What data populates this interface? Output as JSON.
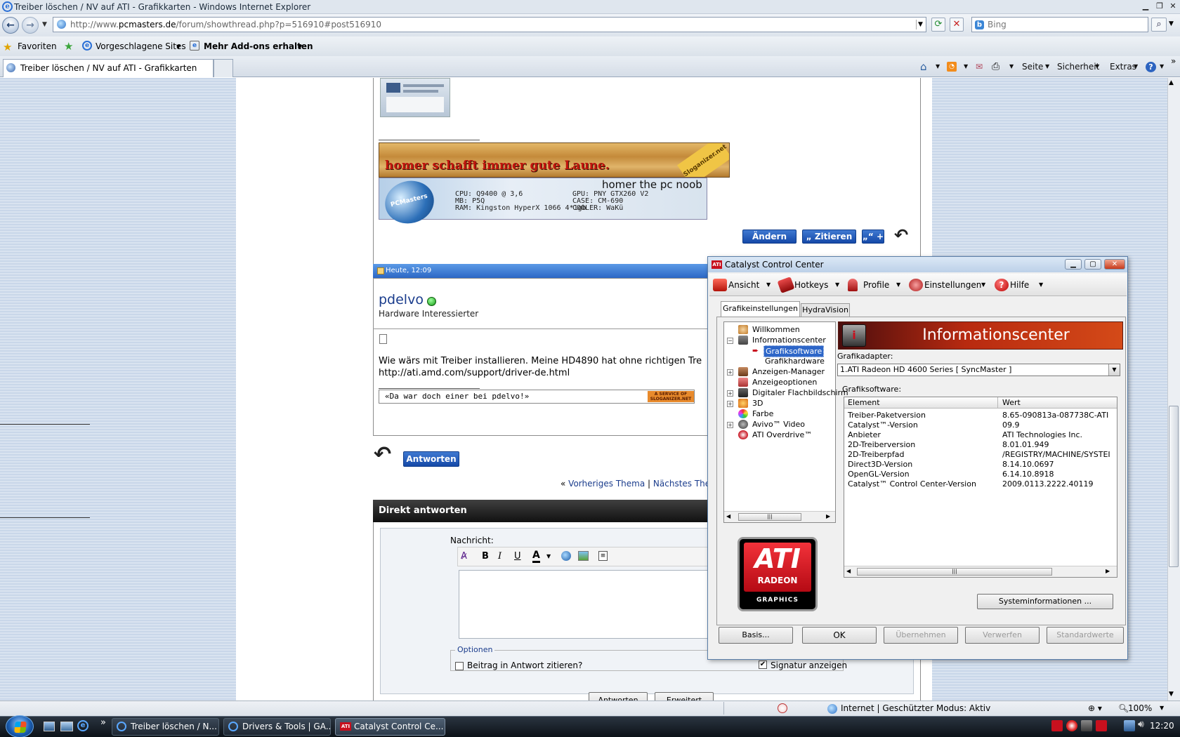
{
  "window": {
    "title": "Treiber löschen / NV auf ATI - Grafikkarten - Windows Internet Explorer"
  },
  "address": {
    "url_prefix": "http://www.",
    "url_domain": "pcmasters.de",
    "url_path": "/forum/showthread.php?p=516910#post516910",
    "search_placeholder": "Bing"
  },
  "favorites_bar": {
    "favorites": "Favoriten",
    "suggested": "Vorgeschlagene Sites",
    "addons": "Mehr Add-ons erhalten"
  },
  "tab": {
    "title": "Treiber löschen / NV auf ATI - Grafikkarten"
  },
  "command_bar": {
    "page": "Seite",
    "security": "Sicherheit",
    "extras": "Extras"
  },
  "post1": {
    "banner_title": "homer schafft immer gute Laune.",
    "banner_stamp": "Sloganizer.net",
    "sig_name": "homer the pc noob",
    "sig_logo": "PCMasters",
    "specs_left": [
      "CPU: Q9400 @ 3,6",
      "MB: P5Q",
      "RAM: Kingston HyperX 1066 4*1gb"
    ],
    "specs_right": [
      "GPU: PNY GTX260 V2",
      "CASE: CM-690",
      "COOLER: WaKü"
    ],
    "buttons": {
      "edit": "Ändern",
      "quote": "„ Zitieren “",
      "multi": "„“ +"
    }
  },
  "post2": {
    "date": "Heute, 12:09",
    "username": "pdelvo",
    "usertitle": "Hardware Interessierter",
    "text_line1": "Wie wärs mit Treiber installieren. Meine HD4890 hat ohne richtigen Tre",
    "text_line2": "http://ati.amd.com/support/driver-de.html",
    "signature": "«Da war doch einer bei pdelvo!»",
    "sloganizer_badge": "A SERVICE OF SLOGANIZER.NET"
  },
  "reply_button": "Antworten",
  "thread_nav": {
    "prefix": "«",
    "prev": "Vorheriges Thema",
    "sep": "|",
    "next": "Nächstes Ther"
  },
  "quick_reply": {
    "header": "Direkt antworten",
    "message_label": "Nachricht:",
    "options_legend": "Optionen",
    "quote_option": "Beitrag in Antwort zitieren?",
    "signature_option": "Signatur anzeigen",
    "submit": "Antworten",
    "advanced": "Erweitert"
  },
  "status_bar": {
    "zone": "Internet | Geschützter Modus: Aktiv",
    "zoom": "100%"
  },
  "taskbar": {
    "tasks": [
      "Treiber löschen / N...",
      "Drivers & Tools | GA...",
      "Catalyst Control Ce..."
    ],
    "clock": "12:20"
  },
  "ccc": {
    "title": "Catalyst Control Center",
    "logo_text": "ATI",
    "toolbar": {
      "view": "Ansicht",
      "hotkeys": "Hotkeys",
      "profiles": "Profile",
      "settings": "Einstellungen",
      "help": "Hilfe"
    },
    "tabs": {
      "graphics": "Grafikeinstellungen",
      "hydravision": "HydraVision"
    },
    "tree": [
      {
        "label": "Willkommen"
      },
      {
        "label": "Informationscenter"
      },
      {
        "label": "Grafiksoftware"
      },
      {
        "label": "Grafikhardware"
      },
      {
        "label": "Anzeigen-Manager"
      },
      {
        "label": "Anzeigeoptionen"
      },
      {
        "label": "Digitaler Flachbildschirm"
      },
      {
        "label": "3D"
      },
      {
        "label": "Farbe"
      },
      {
        "label": "Avivo™ Video"
      },
      {
        "label": "ATI Overdrive™"
      }
    ],
    "ati_logo": {
      "brand": "ATI",
      "line1": "RADEON",
      "line2": "GRAPHICS"
    },
    "info_header": "Informationscenter",
    "adapter_label": "Grafikadapter:",
    "adapter_value": "1.ATI Radeon HD 4600 Series  [ SyncMaster ]",
    "software_label": "Grafiksoftware:",
    "columns": [
      "Element",
      "Wert"
    ],
    "rows": [
      {
        "element": "Treiber-Paketversion",
        "value": "8.65-090813a-087738C-ATI"
      },
      {
        "element": "Catalyst™-Version",
        "value": "09.9"
      },
      {
        "element": "Anbieter",
        "value": "ATI Technologies Inc."
      },
      {
        "element": "2D-Treiberversion",
        "value": "8.01.01.949"
      },
      {
        "element": "2D-Treiberpfad",
        "value": "/REGISTRY/MACHINE/SYSTEI"
      },
      {
        "element": "Direct3D-Version",
        "value": "8.14.10.0697"
      },
      {
        "element": "OpenGL-Version",
        "value": "6.14.10.8918"
      },
      {
        "element": "Catalyst™ Control Center-Version",
        "value": "2009.0113.2222.40119"
      }
    ],
    "system_info_button": "Systeminformationen ...",
    "buttons": {
      "basic": "Basis...",
      "ok": "OK",
      "apply": "Übernehmen",
      "discard": "Verwerfen",
      "defaults": "Standardwerte"
    }
  },
  "colors": {
    "forum_blue": "#1549a8",
    "ati_red": "#c8101e",
    "stripe": "#c9d7e9"
  }
}
